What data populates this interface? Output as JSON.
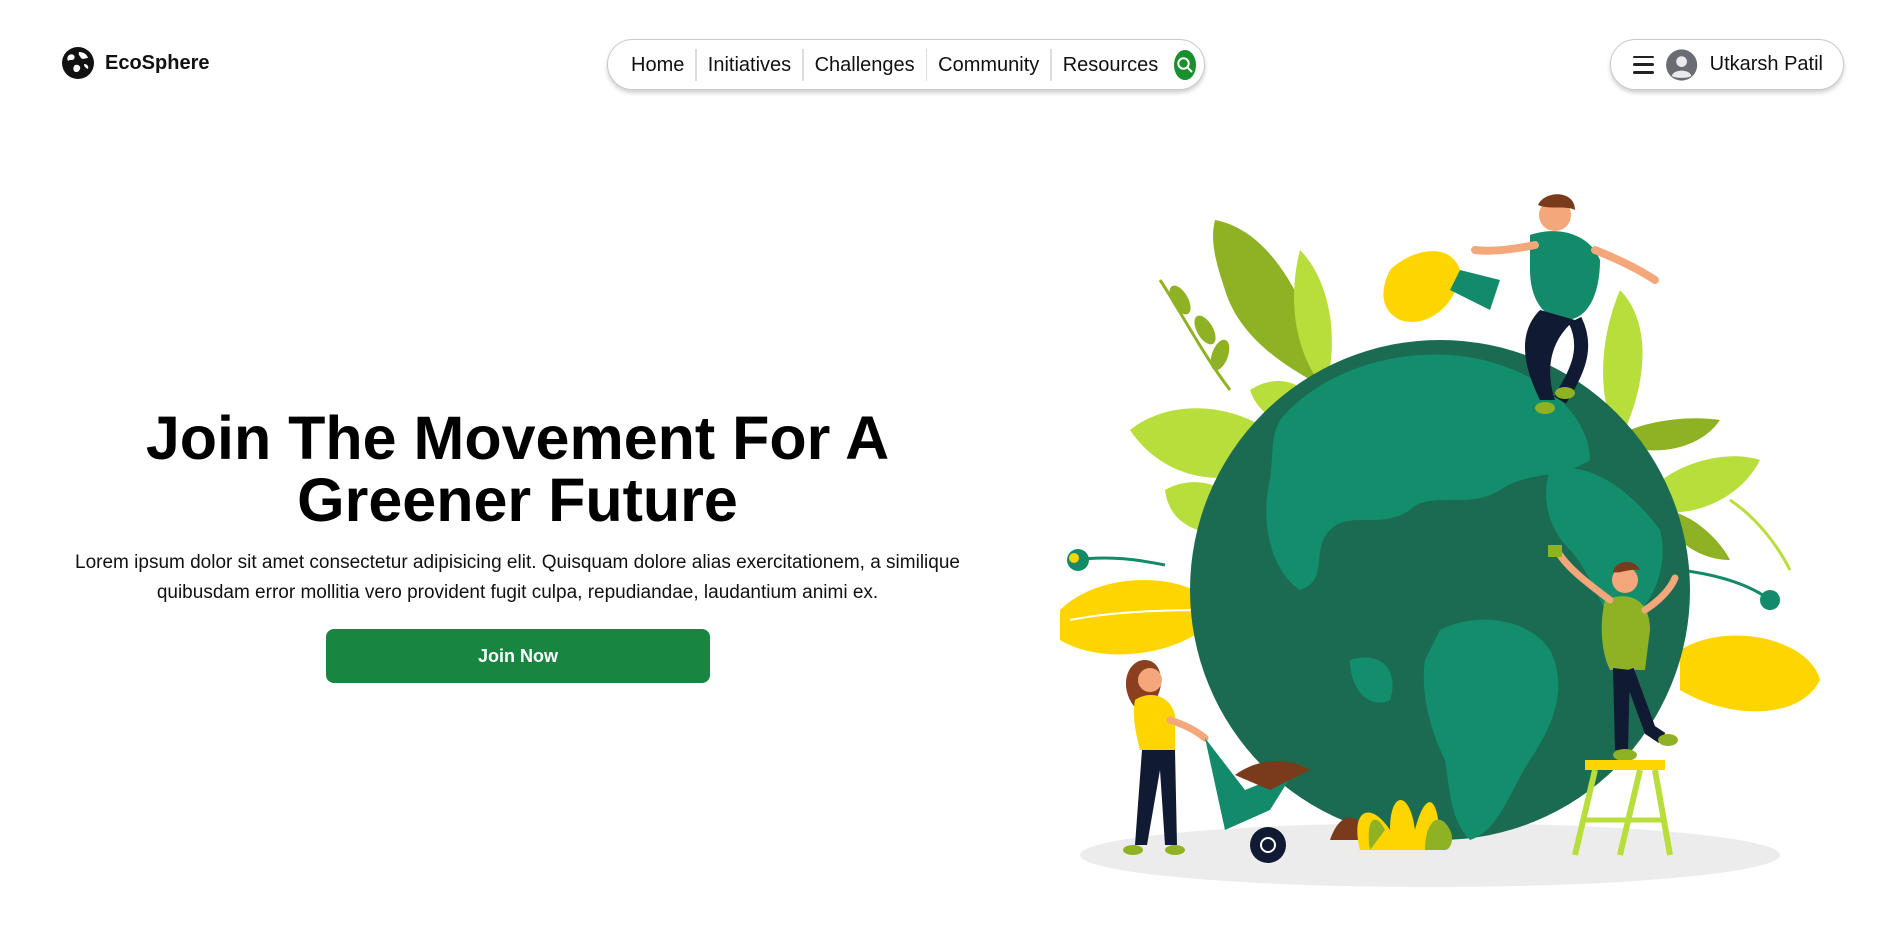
{
  "brand": {
    "name": "EcoSphere",
    "logo_icon": "globe-logo-icon"
  },
  "nav": {
    "items": [
      {
        "label": "Home"
      },
      {
        "label": "Initiatives"
      },
      {
        "label": "Challenges"
      },
      {
        "label": "Community"
      },
      {
        "label": "Resources"
      }
    ],
    "search_icon": "search-icon"
  },
  "user": {
    "name": "Utkarsh Patil",
    "menu_icon": "hamburger-menu-icon",
    "avatar_icon": "user-avatar-icon"
  },
  "hero": {
    "title": "Join The Movement For A Greener Future",
    "description": "Lorem ipsum dolor sit amet consectetur adipisicing elit. Quisquam dolore alias exercitationem, a similique quibusdam error mollitia vero provident fugit culpa, repudiandae, laudantium animi ex.",
    "cta_label": "Join Now"
  },
  "colors": {
    "accent": "#188640",
    "globe_dark": "#1b6b52",
    "globe_light": "#13906e",
    "leaf_lime": "#b8de3c",
    "leaf_yellow": "#ffd500"
  }
}
